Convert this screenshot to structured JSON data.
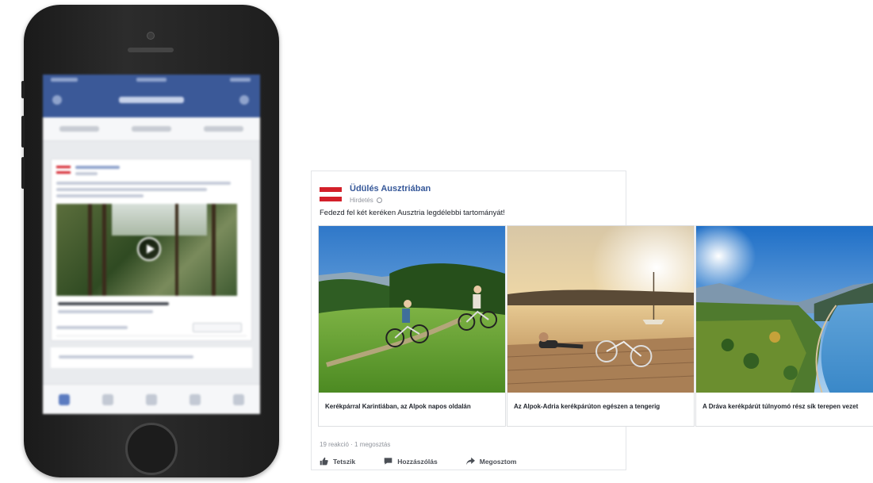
{
  "post": {
    "page_name": "Üdülés Ausztriában",
    "meta": "Hirdetés",
    "text": "Fedezd fel két keréken Ausztria legdélebbi tartományát!",
    "stats": "19 reakció · 1 megosztás",
    "actions": {
      "like": "Tetszik",
      "comment": "Hozzászólás",
      "share": "Megosztom"
    }
  },
  "carousel": [
    {
      "caption": "Kerékpárral Karintiában, az Alpok napos oldalán",
      "image": "cyclists-on-meadow-photo"
    },
    {
      "caption": "Az Alpok-Adria kerékpárúton egészen a tengerig",
      "image": "lake-sunset-dock-photo"
    },
    {
      "caption": "A Dráva kerékpárút túlnyomó rész sík terepen vezet",
      "image": "drava-river-valley-photo"
    }
  ],
  "colors": {
    "facebook_blue": "#3b5998",
    "link_blue": "#365899",
    "austria_red": "#d3202a"
  }
}
